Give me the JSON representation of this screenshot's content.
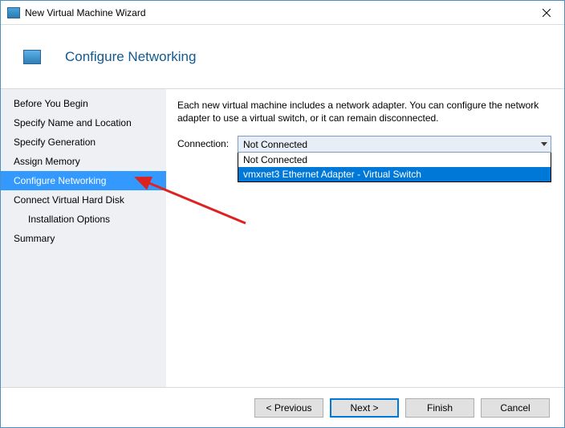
{
  "window": {
    "title": "New Virtual Machine Wizard"
  },
  "header": {
    "title": "Configure Networking"
  },
  "sidebar": {
    "items": [
      {
        "label": "Before You Begin",
        "selected": false
      },
      {
        "label": "Specify Name and Location",
        "selected": false
      },
      {
        "label": "Specify Generation",
        "selected": false
      },
      {
        "label": "Assign Memory",
        "selected": false
      },
      {
        "label": "Configure Networking",
        "selected": true
      },
      {
        "label": "Connect Virtual Hard Disk",
        "selected": false
      },
      {
        "label": "Installation Options",
        "selected": false,
        "indent": true
      },
      {
        "label": "Summary",
        "selected": false
      }
    ]
  },
  "main": {
    "description": "Each new virtual machine includes a network adapter. You can configure the network adapter to use a virtual switch, or it can remain disconnected.",
    "connection_label": "Connection:",
    "connection_selected": "Not Connected",
    "connection_options": [
      {
        "label": "Not Connected",
        "highlighted": false
      },
      {
        "label": "vmxnet3 Ethernet Adapter - Virtual Switch",
        "highlighted": true
      }
    ]
  },
  "footer": {
    "previous": "< Previous",
    "next": "Next >",
    "finish": "Finish",
    "cancel": "Cancel"
  }
}
